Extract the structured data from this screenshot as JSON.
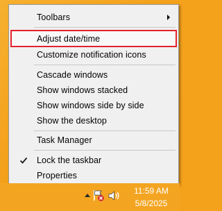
{
  "menu": {
    "items": [
      {
        "label": "Toolbars",
        "has_submenu": true
      },
      {
        "label": "Adjust date/time",
        "highlighted": true
      },
      {
        "label": "Customize notification icons"
      },
      {
        "label": "Cascade windows"
      },
      {
        "label": "Show windows stacked"
      },
      {
        "label": "Show windows side by side"
      },
      {
        "label": "Show the desktop"
      },
      {
        "label": "Task Manager"
      },
      {
        "label": "Lock the taskbar",
        "checked": true
      },
      {
        "label": "Properties"
      }
    ]
  },
  "taskbar": {
    "clock": {
      "time": "11:59 AM",
      "date": "5/8/2025"
    },
    "tray_icons": [
      "show-hidden-icons-arrow",
      "action-center-flag-icon",
      "speaker-icon"
    ]
  },
  "colors": {
    "highlight_border": "#e4222c",
    "taskbar": "#f3a522",
    "desktop": "#f29d16"
  }
}
